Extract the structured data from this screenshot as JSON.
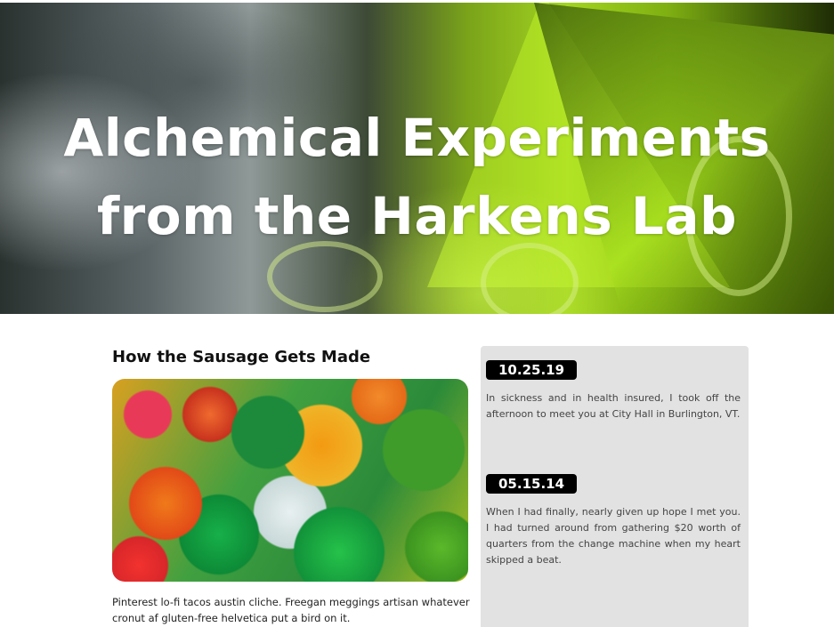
{
  "hero": {
    "title_line1": "Alchemical Experiments",
    "title_line2": "from the Harkens Lab"
  },
  "main": {
    "section_title": "How the Sausage Gets Made",
    "body": "Pinterest lo-fi tacos austin cliche. Freegan meggings artisan whatever cronut af gluten-free helvetica put a bird on it."
  },
  "sidebar": {
    "entries": [
      {
        "date": "10.25.19",
        "text": "In sickness and in health insured, I took off the afternoon to meet you at City Hall in Burlington, VT."
      },
      {
        "date": "05.15.14",
        "text": "When I had finally, nearly given up hope I met you. I had turned around from gathering $20 worth of quarters from the change machine when my heart skipped a beat."
      }
    ]
  },
  "colors": {
    "badge_bg": "#000000",
    "sidebar_bg": "#e2e2e2",
    "hero_accent": "#a3d420"
  }
}
